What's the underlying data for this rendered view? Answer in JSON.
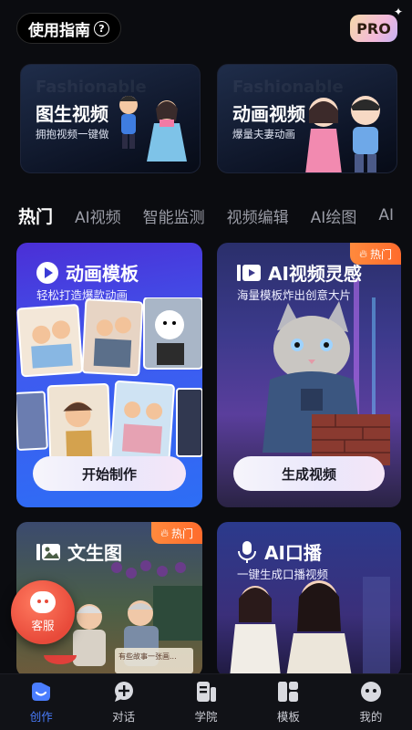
{
  "header": {
    "guide_label": "使用指南",
    "guide_icon": "question-circle-icon",
    "pro_label": "PRO"
  },
  "banners": [
    {
      "title": "图生视频",
      "subtitle": "拥抱视频一键做",
      "ghost": "Fashionable"
    },
    {
      "title": "动画视频",
      "subtitle": "爆量夫妻动画",
      "ghost": "Fashionable"
    }
  ],
  "tabs": [
    "热门",
    "AI视频",
    "智能监测",
    "视频编辑",
    "AI绘图",
    "AI"
  ],
  "cards": {
    "anim": {
      "title": "动画模板",
      "subtitle": "轻松打造爆款动画",
      "button": "开始制作"
    },
    "aivideo": {
      "title": "AI视频灵感",
      "subtitle": "海量模板炸出创意大片",
      "button": "生成视频",
      "badge": "热门"
    },
    "text2img": {
      "title": "文生图",
      "badge": "热门",
      "caption": "有些故事一张画..."
    },
    "aibroadcast": {
      "title": "AI口播",
      "subtitle": "一键生成口播视频"
    }
  },
  "float_service": {
    "label": "客服"
  },
  "nav": [
    {
      "label": "创作",
      "icon": "create-icon",
      "active": true
    },
    {
      "label": "对话",
      "icon": "chat-icon",
      "active": false
    },
    {
      "label": "学院",
      "icon": "academy-icon",
      "active": false
    },
    {
      "label": "模板",
      "icon": "template-icon",
      "active": false
    },
    {
      "label": "我的",
      "icon": "profile-icon",
      "active": false
    }
  ],
  "colors": {
    "accent": "#4a7dff",
    "hot": "#ff7a2f",
    "service": "#e84a3a"
  }
}
